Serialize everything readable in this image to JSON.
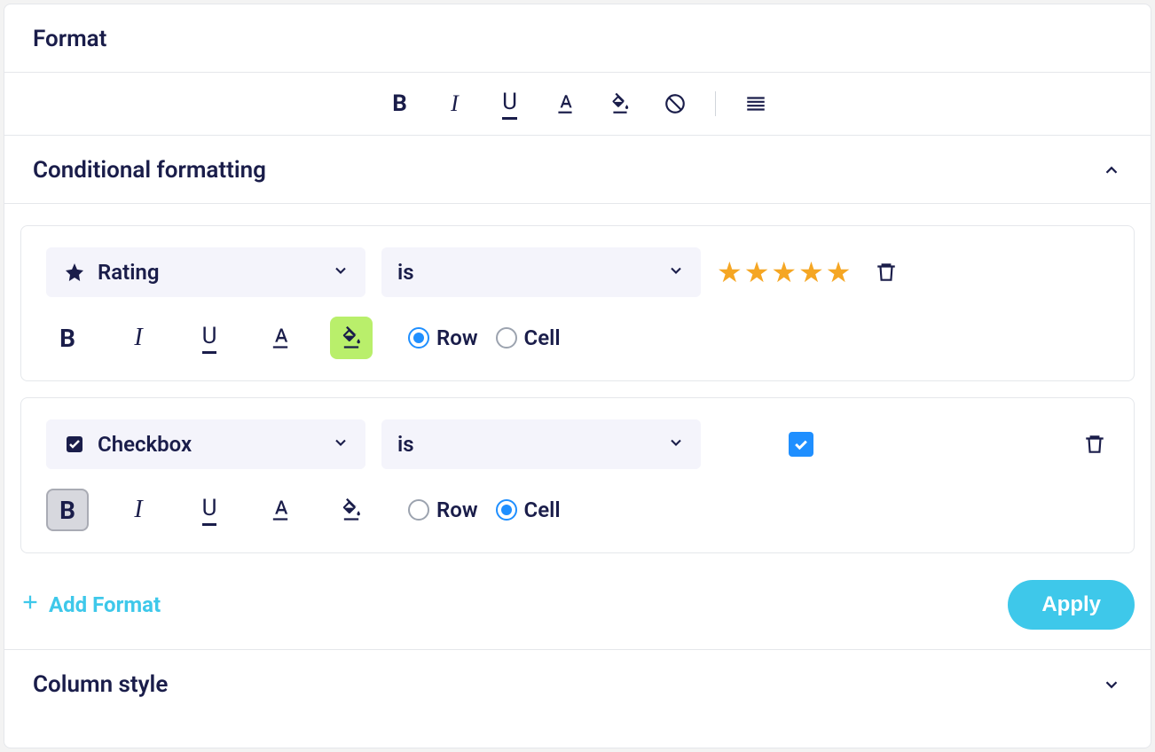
{
  "header": {
    "title": "Format"
  },
  "conditional": {
    "title": "Conditional formatting",
    "expanded": true
  },
  "rules": [
    {
      "field": {
        "icon": "star-icon",
        "label": "Rating"
      },
      "operator": "is",
      "value": {
        "type": "stars",
        "count": 5
      },
      "format_active": "fill",
      "scope": "Row"
    },
    {
      "field": {
        "icon": "checkbox-icon",
        "label": "Checkbox"
      },
      "operator": "is",
      "value": {
        "type": "checkbox",
        "checked": true
      },
      "format_active": "bold",
      "scope": "Cell"
    }
  ],
  "scope_labels": {
    "row": "Row",
    "cell": "Cell"
  },
  "footer": {
    "add_label": "Add Format",
    "apply_label": "Apply"
  },
  "column_style": {
    "title": "Column style",
    "expanded": false
  }
}
